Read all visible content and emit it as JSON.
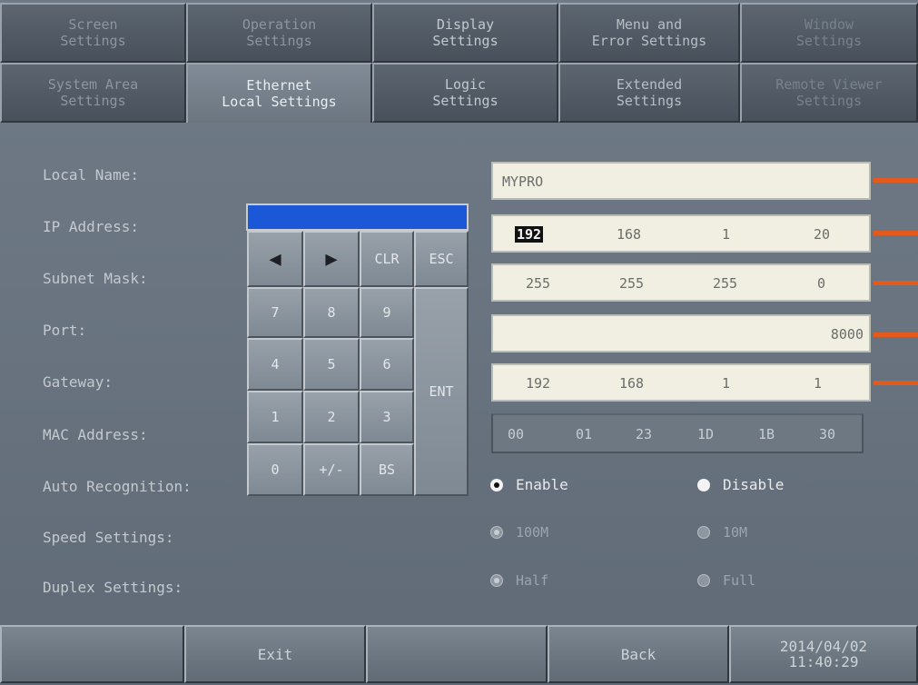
{
  "tabs_row1": [
    "Screen\nSettings",
    "Operation\nSettings",
    "Display\nSettings",
    "Menu and\nError Settings",
    "Window\nSettings"
  ],
  "tabs_row2": [
    "System Area\nSettings",
    "Ethernet\nLocal Settings",
    "Logic\nSettings",
    "Extended\nSettings",
    "Remote Viewer\nSettings"
  ],
  "labels": {
    "local_name": "Local Name:",
    "ip": "IP Address:",
    "subnet": "Subnet Mask:",
    "port": "Port:",
    "gateway": "Gateway:",
    "mac": "MAC Address:",
    "auto": "Auto Recognition:",
    "speed": "Speed Settings:",
    "duplex": "Duplex Settings:"
  },
  "keypad": {
    "left": "◀",
    "right": "▶",
    "clr": "CLR",
    "esc": "ESC",
    "k7": "7",
    "k8": "8",
    "k9": "9",
    "k4": "4",
    "k5": "5",
    "k6": "6",
    "k1": "1",
    "k2": "2",
    "k3": "3",
    "k0": "0",
    "pm": "+/-",
    "bs": "BS",
    "ent": "ENT"
  },
  "local_name": "MYPRO",
  "ip": [
    "192",
    "168",
    "1",
    "20"
  ],
  "subnet": [
    "255",
    "255",
    "255",
    "0"
  ],
  "port": "8000",
  "gateway": [
    "192",
    "168",
    "1",
    "1"
  ],
  "mac": [
    "00",
    "01",
    "23",
    "1D",
    "1B",
    "30"
  ],
  "auto": {
    "enable": "Enable",
    "disable": "Disable",
    "selected": "Enable"
  },
  "speed": {
    "a": "100M",
    "b": "10M",
    "selected": "100M"
  },
  "duplex": {
    "a": "Half",
    "b": "Full",
    "selected": "Half"
  },
  "bottom": {
    "exit": "Exit",
    "back": "Back",
    "date": "2014/04/02",
    "time": "11:40:29"
  },
  "colors": {
    "marker": "#e35a1d",
    "keypad_display": "#1a58d8"
  }
}
